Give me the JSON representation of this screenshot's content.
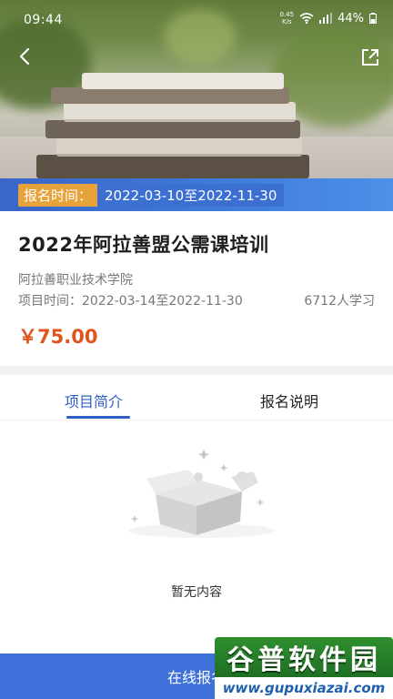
{
  "status_bar": {
    "time": "09:44",
    "net_speed_value": "0.45",
    "net_speed_unit": "K/s",
    "battery": "44%"
  },
  "header": {
    "back_icon": "chevron-left-icon",
    "share_icon": "share-external-icon"
  },
  "registration": {
    "label": "报名时间：",
    "period": "2022-03-10至2022-11-30"
  },
  "course": {
    "title": "2022年阿拉善盟公需课培训",
    "organization": "阿拉善职业技术学院",
    "project_time_label": "项目时间：",
    "project_time": "2022-03-14至2022-11-30",
    "learners": "6712人学习",
    "price": "￥75.00"
  },
  "tabs": [
    {
      "label": "项目简介",
      "active": true
    },
    {
      "label": "报名说明",
      "active": false
    }
  ],
  "empty_state": {
    "icon": "empty-box-icon",
    "message": "暂无内容"
  },
  "bottom": {
    "action_label": "在线报名"
  },
  "watermark": {
    "brand": "谷普软件园",
    "url": "www.gupuxiazai.com"
  },
  "colors": {
    "accent": "#2f5fc4",
    "price": "#e0541f",
    "tag": "#e8a23a",
    "button": "#3e72da"
  }
}
